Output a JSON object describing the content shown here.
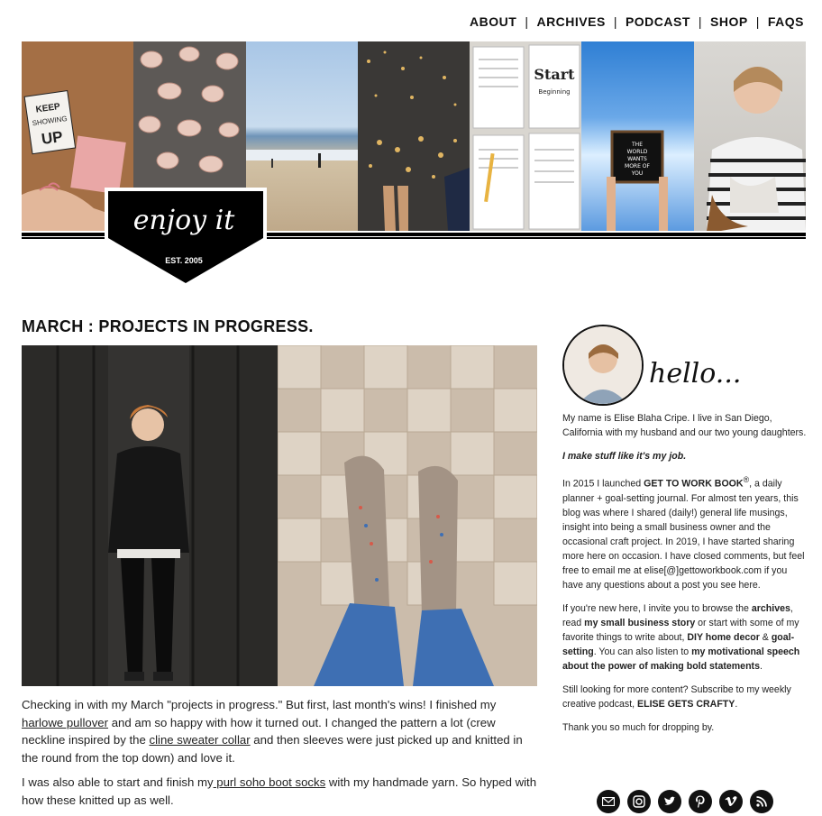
{
  "nav": {
    "items": [
      "ABOUT",
      "ARCHIVES",
      "PODCAST",
      "SHOP",
      "FAQS"
    ],
    "separator": "|"
  },
  "logo": {
    "script_text": "enjoy it",
    "est_text": "EST. 2005"
  },
  "banner": {
    "keep_sign": "KEEP SHOWING UP",
    "start_text": "Start Beginning",
    "letterboard": "THE WORLD WANTS MORE OF YOU"
  },
  "post": {
    "title": "MARCH : PROJECTS IN PROGRESS.",
    "p1_a": "Checking in with my March \"projects in progress.\" But first, last month's wins! I finished my ",
    "link_harlowe": "harlowe pullover",
    "p1_b": " and am so happy with how it turned out. I changed the pattern a lot (crew neckline inspired by the ",
    "link_cline": "cline sweater collar",
    "p1_c": " and then sleeves were just picked up and knitted in the round from the top down) and love it.",
    "p2_a": "I was also able to start and finish my",
    "link_socks": " purl soho boot socks",
    "p2_b": " with my handmade yarn. So hyped with how these knitted up as well."
  },
  "sidebar": {
    "hello": "hello...",
    "intro": "My name is Elise Blaha Cripe. I live in San Diego, California with my husband and our two young daughters.",
    "tagline": "I make stuff like it's my job.",
    "gtwb_a": "In 2015 I launched ",
    "gtwb_strong": "GET TO WORK BOOK",
    "gtwb_reg": "®",
    "gtwb_b": ", a daily planner + goal-setting journal. For almost ten years, this blog was where I shared (daily!) general life musings, insight into being a small business owner and the occasional craft project. In 2019, I have started sharing more here on occasion. I have closed comments, but feel free to email me at elise[@]gettoworkbook.com if you have any questions about a post you see here.",
    "new_a": "If you're new here, I invite you to browse the ",
    "new_archives": "archives",
    "new_b": ", read ",
    "new_story": "my small business story",
    "new_c": " or start with some of my favorite things to write about, ",
    "new_decor": "DIY home decor",
    "new_d": " & ",
    "new_goal": "goal-setting",
    "new_e": ". You can also listen to ",
    "new_speech": "my motivational speech about the power of making bold statements",
    "new_f": ".",
    "podcast_a": "Still looking for more content? Subscribe to my weekly creative podcast, ",
    "podcast_name": "ELISE GETS CRAFTY",
    "podcast_b": ".",
    "thanks": "Thank you so much for dropping by."
  },
  "social_icons": [
    "email-icon",
    "instagram-icon",
    "twitter-icon",
    "pinterest-icon",
    "vimeo-icon",
    "rss-icon"
  ],
  "colors": {
    "text": "#222222",
    "accent": "#000000",
    "background": "#ffffff"
  }
}
